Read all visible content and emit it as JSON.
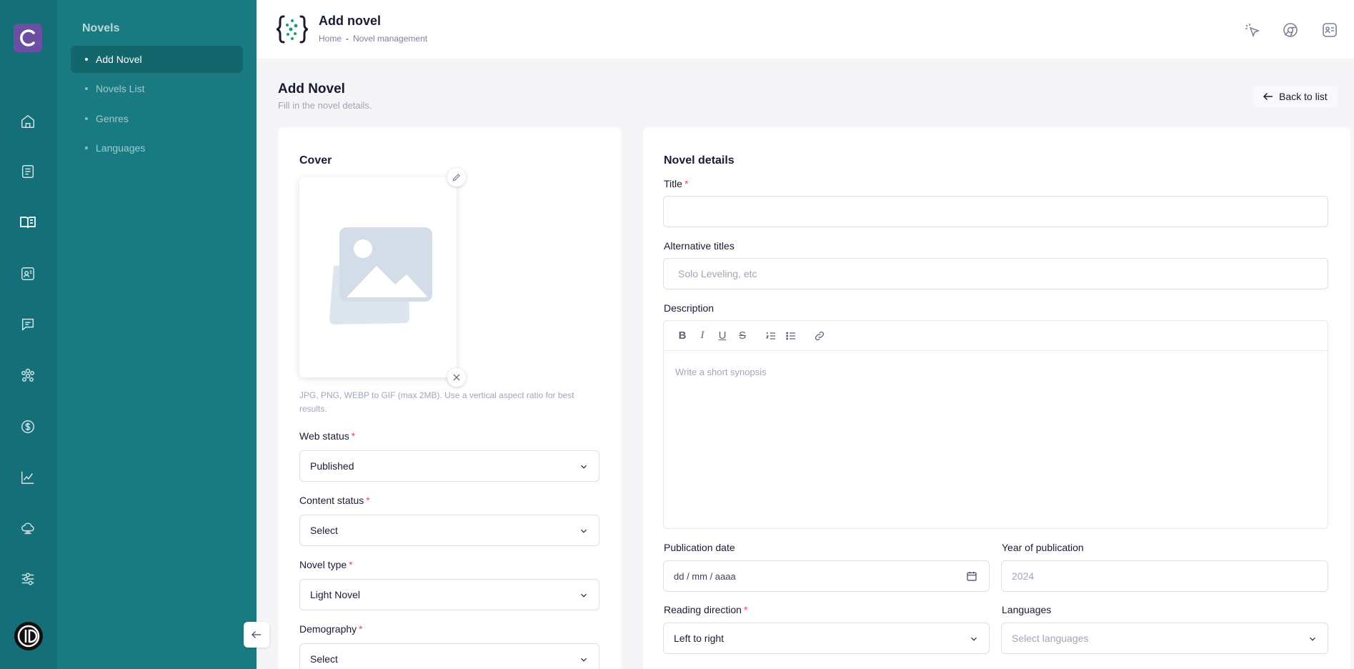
{
  "sidebar": {
    "section_title": "Novels",
    "items": [
      {
        "label": "Add Novel",
        "active": true
      },
      {
        "label": "Novels List",
        "active": false
      },
      {
        "label": "Genres",
        "active": false
      },
      {
        "label": "Languages",
        "active": false
      }
    ],
    "rail_icons": [
      "home-icon",
      "document-icon",
      "book-icon",
      "profile-card-icon",
      "chat-icon",
      "users-icon",
      "dollar-icon",
      "chart-icon",
      "cloud-icon",
      "settings-icon"
    ]
  },
  "header": {
    "title": "Add novel",
    "breadcrumb": [
      "Home",
      "-",
      "Novel management"
    ],
    "right_icons": [
      "cursor-click-icon",
      "chrome-icon",
      "profile-icon"
    ]
  },
  "page": {
    "title": "Add Novel",
    "subtitle": "Fill in the novel details.",
    "back_label": "Back to list"
  },
  "left_card": {
    "cover_title": "Cover",
    "hint": "JPG, PNG, WEBP to GIF (max 2MB). Use a vertical aspect ratio for best results.",
    "web_status": {
      "label": "Web status",
      "required": "*",
      "value": "Published"
    },
    "content_status": {
      "label": "Content status",
      "required": "*",
      "value": "Select"
    },
    "novel_type": {
      "label": "Novel type",
      "required": "*",
      "value": "Light Novel"
    },
    "demography": {
      "label": "Demography",
      "required": "*",
      "value": "Select"
    }
  },
  "right_card": {
    "title": "Novel details",
    "title_field": {
      "label": "Title",
      "required": "*",
      "value": "",
      "placeholder": ""
    },
    "alt_titles": {
      "label": "Alternative titles",
      "placeholder": "Solo Leveling, etc"
    },
    "description": {
      "label": "Description",
      "placeholder": "Write a short synopsis"
    },
    "publication_date": {
      "label": "Publication date",
      "placeholder": "dd / mm / aaaa"
    },
    "year_of_publication": {
      "label": "Year of publication",
      "placeholder": "2024"
    },
    "reading_direction": {
      "label": "Reading direction",
      "required": "*",
      "value": "Left to right"
    },
    "languages": {
      "label": "Languages",
      "placeholder": "Select languages"
    }
  },
  "colors": {
    "rail": "#146f78",
    "submenu": "#1a7a82",
    "active_item": "#14666d",
    "required": "#f1416c",
    "logo": "#6a4fa3"
  }
}
